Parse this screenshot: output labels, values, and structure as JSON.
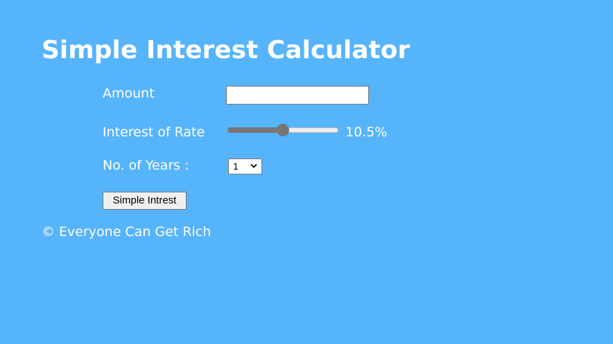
{
  "page": {
    "title": "Simple Interest Calculator",
    "background_color": "#56b4fb",
    "text_color": "#ffffff"
  },
  "form": {
    "amount": {
      "label": "Amount",
      "value": "",
      "placeholder": ""
    },
    "rate": {
      "label": "Interest of Rate",
      "value": 10.5,
      "min": 1,
      "max": 20,
      "display": "10.5%"
    },
    "years": {
      "label": "No. of Years :",
      "selected": "1",
      "icon": "chevron-down-icon"
    },
    "submit": {
      "label": "Simple Intrest"
    }
  },
  "footer": {
    "text": "© Everyone Can Get Rich"
  }
}
